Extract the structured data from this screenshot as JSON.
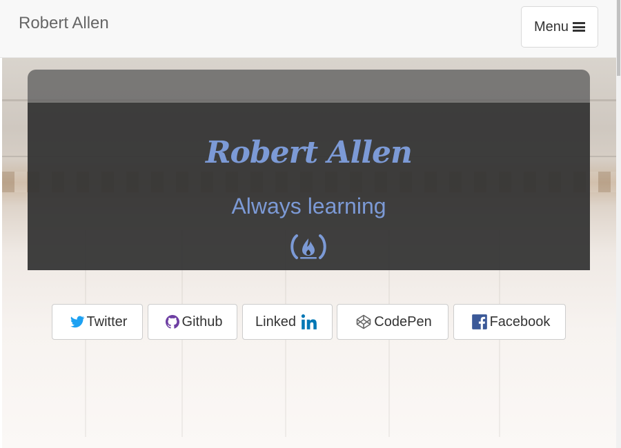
{
  "navbar": {
    "brand": "Robert Allen",
    "menu_label": "Menu",
    "menu_icon": "hamburger-icon"
  },
  "hero": {
    "name": "Robert Allen",
    "tagline": "Always learning",
    "logo_icon": "freecodecamp-icon",
    "colors": {
      "accent": "#7c9ad6",
      "card": "#323232"
    }
  },
  "social": [
    {
      "label": "Twitter",
      "icon": "twitter-icon",
      "color": "#1da1f2"
    },
    {
      "label": "Github",
      "icon": "github-icon",
      "color": "#6e3fa3"
    },
    {
      "label": "Linked",
      "icon": "linkedin-icon",
      "color": "#0077b5"
    },
    {
      "label": "CodePen",
      "icon": "codepen-icon",
      "color": "#666666"
    },
    {
      "label": "Facebook",
      "icon": "facebook-icon",
      "color": "#3b5998"
    }
  ]
}
